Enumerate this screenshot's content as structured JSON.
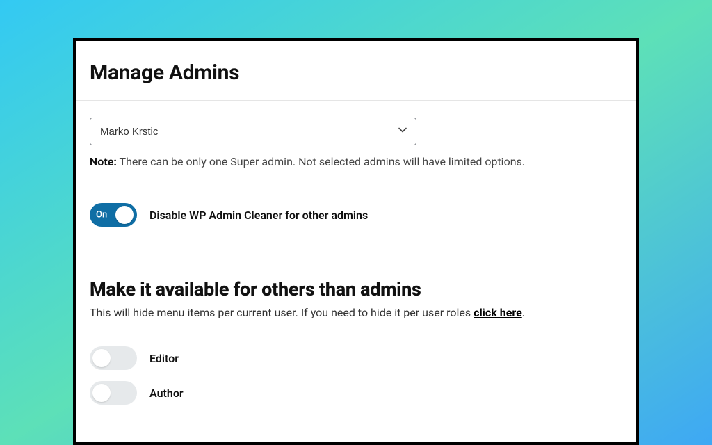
{
  "page": {
    "title": "Manage Admins"
  },
  "admin_select": {
    "value": "Marko Krstic"
  },
  "note": {
    "label": "Note:",
    "text": "There can be only one Super admin. Not selected admins will have limited options."
  },
  "disable_toggle": {
    "state": "on",
    "on_text": "On",
    "label": "Disable WP Admin Cleaner for other admins"
  },
  "section2": {
    "title": "Make it available for others than admins",
    "desc_prefix": "This will hide menu items per current user. If you need to hide it per user roles ",
    "link_text": "click here",
    "desc_suffix": "."
  },
  "roles": [
    {
      "label": "Editor",
      "state": "off"
    },
    {
      "label": "Author",
      "state": "off"
    }
  ]
}
